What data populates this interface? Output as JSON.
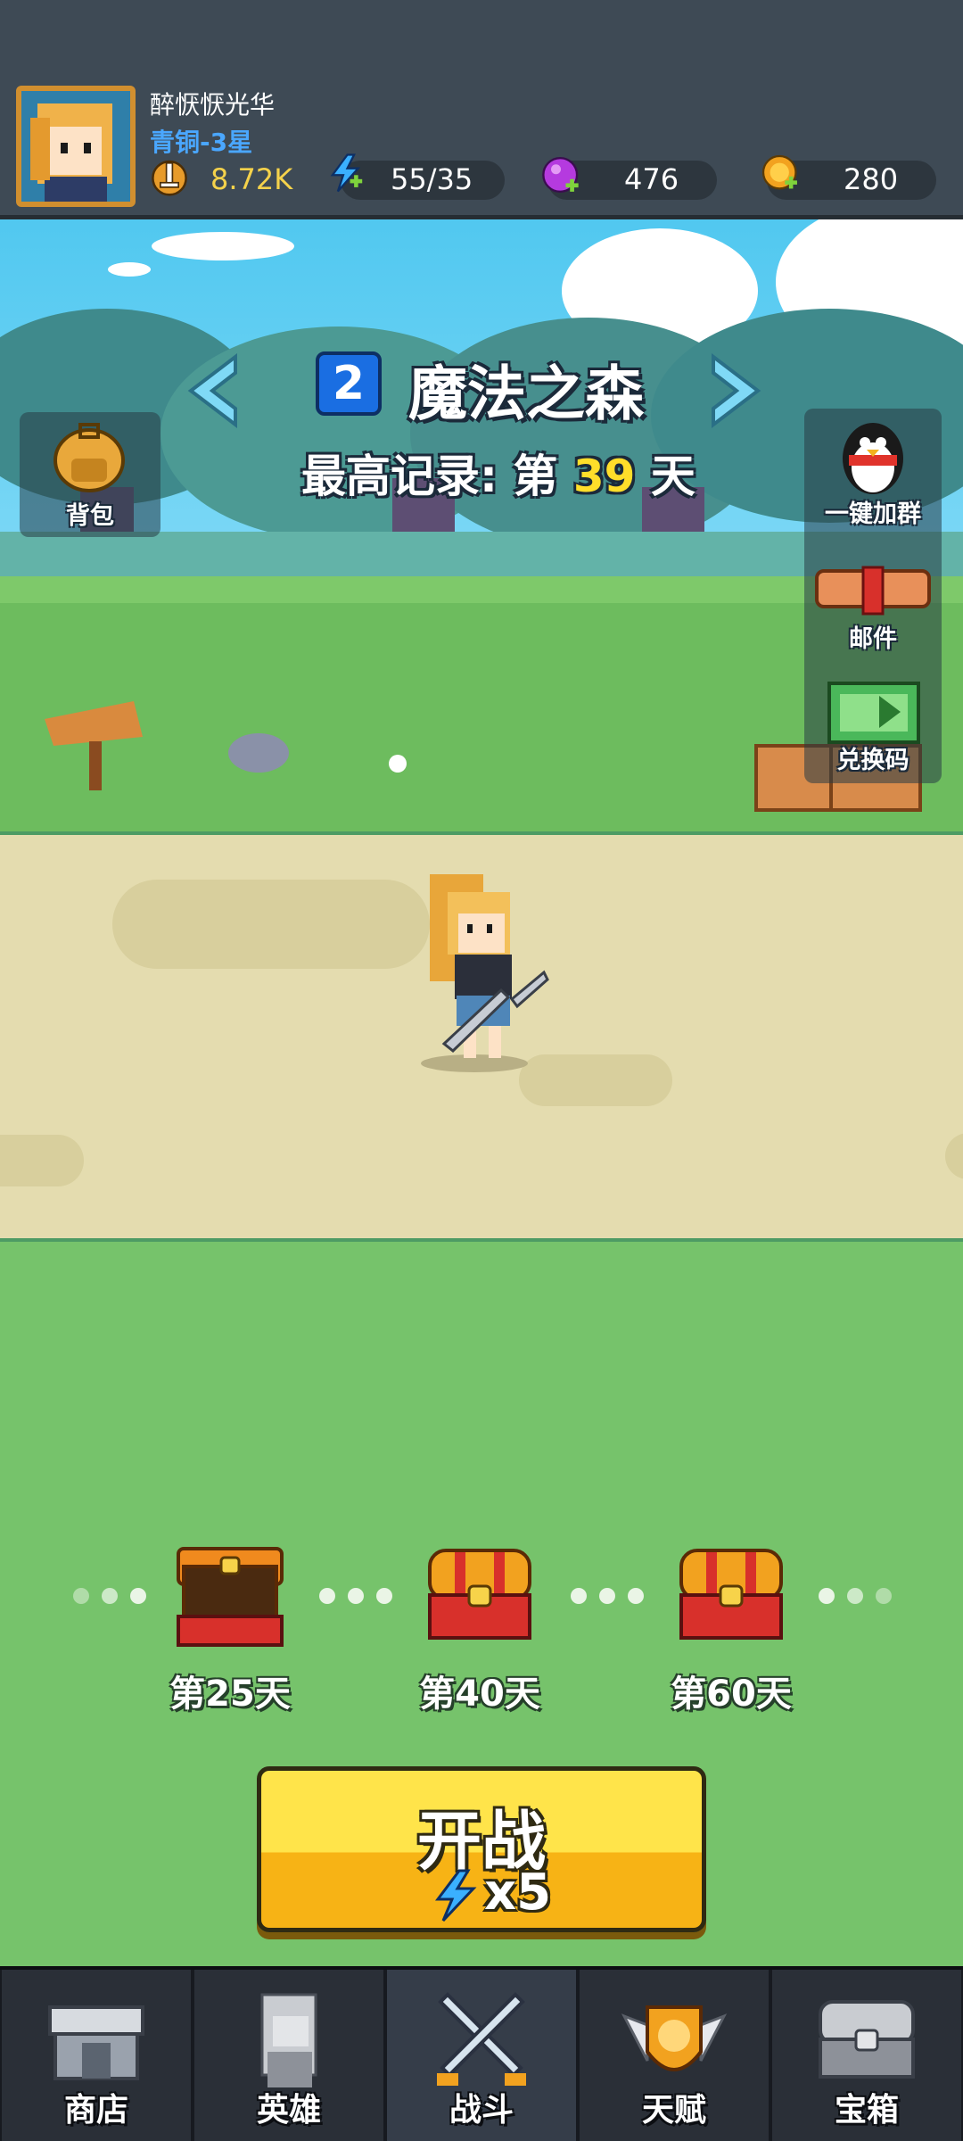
{
  "header": {
    "player_name": "醉恹恹光华",
    "player_rank": "青铜-3星",
    "power": "8.72K",
    "energy": "55/35",
    "gems": "476",
    "coins": "280"
  },
  "stage": {
    "number": "2",
    "name": "魔法之森",
    "record_prefix": "最高记录: 第",
    "record_day": "39",
    "record_suffix": "天"
  },
  "side_buttons": {
    "backpack": "背包",
    "join_group": "一键加群",
    "mail": "邮件",
    "redeem": "兑换码"
  },
  "milestones": [
    {
      "label": "第25天",
      "state": "open"
    },
    {
      "label": "第40天",
      "state": "closed"
    },
    {
      "label": "第60天",
      "state": "closed"
    }
  ],
  "start_button": {
    "label": "开战",
    "cost": "x5"
  },
  "nav": [
    {
      "label": "商店",
      "icon": "shop-icon"
    },
    {
      "label": "英雄",
      "icon": "hero-icon"
    },
    {
      "label": "战斗",
      "icon": "battle-icon"
    },
    {
      "label": "天赋",
      "icon": "talent-icon"
    },
    {
      "label": "宝箱",
      "icon": "chest-icon"
    }
  ],
  "colors": {
    "accent_yellow": "#ffde2a",
    "rank_blue": "#4aa7ff",
    "grass": "#76c36b",
    "path": "#e4dcaf"
  }
}
